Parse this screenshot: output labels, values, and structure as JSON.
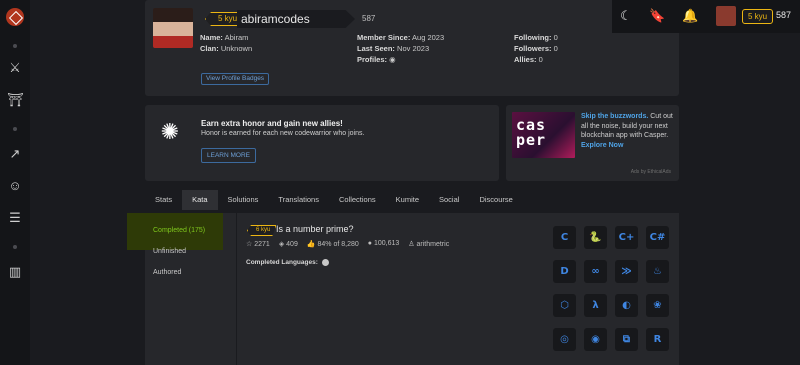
{
  "topbar": {
    "rank": "5 kyu",
    "honor": "587",
    "icons": [
      "moon-icon",
      "bookmark-icon",
      "bell-icon"
    ]
  },
  "sidebar_icons": [
    "codewars-logo-icon",
    "dojo-icon",
    "gym-icon",
    "trending-icon",
    "discord-icon",
    "chat-icon",
    "docs-icon"
  ],
  "profile": {
    "rank": "5 kyu",
    "username": "abiramcodes",
    "honor": "587",
    "name_label": "Name:",
    "name": "Abiram",
    "clan_label": "Clan:",
    "clan": "Unknown",
    "member_since_label": "Member Since:",
    "member_since": "Aug 2023",
    "last_seen_label": "Last Seen:",
    "last_seen": "Nov 2023",
    "profiles_label": "Profiles:",
    "following_label": "Following:",
    "following": "0",
    "followers_label": "Followers:",
    "followers": "0",
    "allies_label": "Allies:",
    "allies": "0",
    "badges_button": "View Profile Badges"
  },
  "promo": {
    "title": "Earn extra honor and gain new allies!",
    "subtitle": "Honor is earned for each new codewarrior who joins.",
    "button": "LEARN MORE"
  },
  "ad": {
    "logo_text": "cas per",
    "headline": "Skip the buzzwords.",
    "body": " Cut out all the noise, build your next blockchain app with Casper. ",
    "cta": "Explore Now",
    "footer": "Ads by EthicalAds"
  },
  "tabs": [
    "Stats",
    "Kata",
    "Solutions",
    "Translations",
    "Collections",
    "Kumite",
    "Social",
    "Discourse"
  ],
  "kata_nav": [
    "Completed (175)",
    "Unfinished",
    "Authored"
  ],
  "kata": {
    "rank": "6 kyu",
    "title": "Is a number prime?",
    "stars": "2271",
    "collections": "409",
    "satisfaction": "84% of 8,280",
    "completed": "100,613",
    "author": "arithmetric",
    "languages_label": "Completed Languages:"
  },
  "languages": [
    {
      "name": "c-icon",
      "glyph": "C"
    },
    {
      "name": "cobra-icon",
      "glyph": "🐍"
    },
    {
      "name": "cpp-icon",
      "glyph": "C+"
    },
    {
      "name": "csharp-icon",
      "glyph": "C#"
    },
    {
      "name": "dart-icon",
      "glyph": "D"
    },
    {
      "name": "go-icon",
      "glyph": "∞"
    },
    {
      "name": "haskell-icon",
      "glyph": "≫"
    },
    {
      "name": "java-icon",
      "glyph": "♨"
    },
    {
      "name": "nodejs-icon",
      "glyph": "⬡"
    },
    {
      "name": "lambda-icon",
      "glyph": "λ"
    },
    {
      "name": "php-icon",
      "glyph": "◐"
    },
    {
      "name": "paw-icon",
      "glyph": "❀"
    },
    {
      "name": "circle-lang-icon",
      "glyph": "◎"
    },
    {
      "name": "eye-lang-icon",
      "glyph": "◉"
    },
    {
      "name": "python-icon",
      "glyph": "⧉"
    },
    {
      "name": "r-icon",
      "glyph": "R"
    }
  ]
}
